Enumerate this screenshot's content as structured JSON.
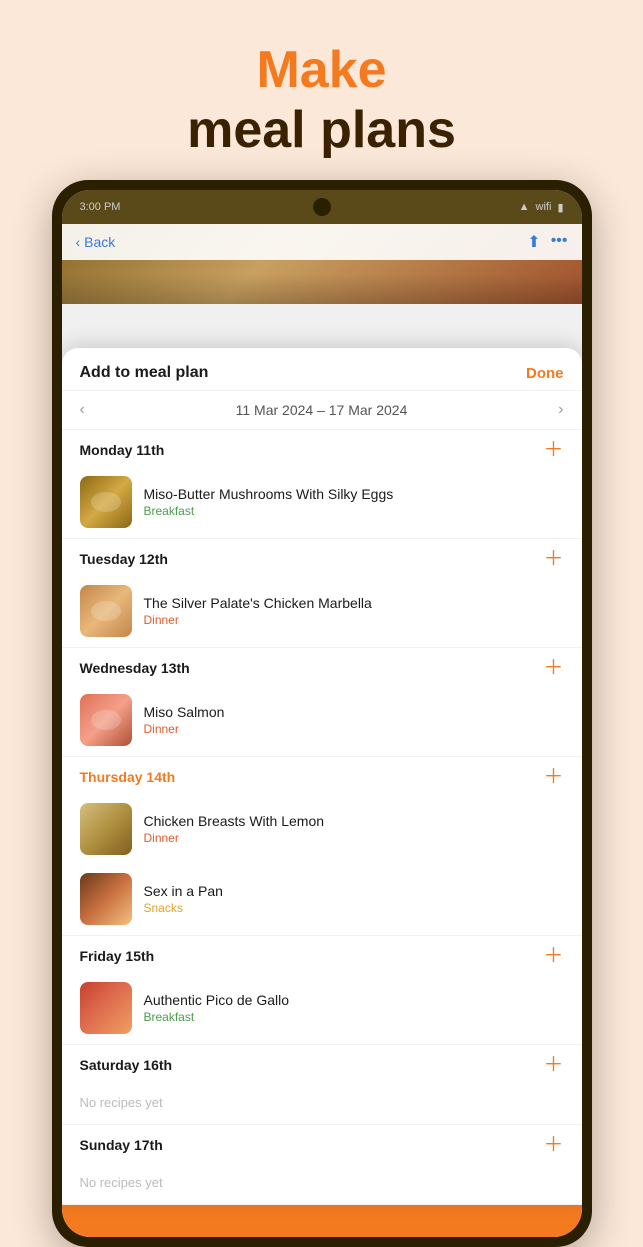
{
  "header": {
    "make_label": "Make",
    "subtitle_label": "meal plans"
  },
  "device": {
    "status_bar": {
      "time": "3:00 PM",
      "icons": "●●●"
    },
    "back_bar": {
      "back_label": "Back"
    }
  },
  "modal": {
    "title": "Add to meal plan",
    "done_label": "Done",
    "week_range": "11 Mar 2024 – 17 Mar 2024",
    "days": [
      {
        "id": "monday",
        "label": "Monday 11th",
        "is_highlighted": false,
        "recipes": [
          {
            "name": "Miso-Butter Mushrooms With Silky Eggs",
            "meal_type": "Breakfast",
            "meal_type_class": "breakfast",
            "thumb_class": "thumb-mushroom"
          }
        ]
      },
      {
        "id": "tuesday",
        "label": "Tuesday 12th",
        "is_highlighted": false,
        "recipes": [
          {
            "name": "The Silver Palate's Chicken Marbella",
            "meal_type": "Dinner",
            "meal_type_class": "dinner",
            "thumb_class": "thumb-chicken"
          }
        ]
      },
      {
        "id": "wednesday",
        "label": "Wednesday 13th",
        "is_highlighted": false,
        "recipes": [
          {
            "name": "Miso Salmon",
            "meal_type": "Dinner",
            "meal_type_class": "dinner",
            "thumb_class": "thumb-salmon"
          }
        ]
      },
      {
        "id": "thursday",
        "label": "Thursday 14th",
        "is_highlighted": true,
        "recipes": [
          {
            "name": "Chicken Breasts With Lemon",
            "meal_type": "Dinner",
            "meal_type_class": "dinner",
            "thumb_class": "thumb-breast"
          },
          {
            "name": "Sex in a Pan",
            "meal_type": "Snacks",
            "meal_type_class": "snacks",
            "thumb_class": "thumb-sexinpan"
          }
        ]
      },
      {
        "id": "friday",
        "label": "Friday 15th",
        "is_highlighted": false,
        "recipes": [
          {
            "name": "Authentic Pico de Gallo",
            "meal_type": "Breakfast",
            "meal_type_class": "breakfast",
            "thumb_class": "thumb-pico"
          }
        ]
      },
      {
        "id": "saturday",
        "label": "Saturday 16th",
        "is_highlighted": false,
        "recipes": [],
        "empty_label": "No recipes yet"
      },
      {
        "id": "sunday",
        "label": "Sunday 17th",
        "is_highlighted": false,
        "recipes": [],
        "empty_label": "No recipes yet"
      }
    ]
  }
}
